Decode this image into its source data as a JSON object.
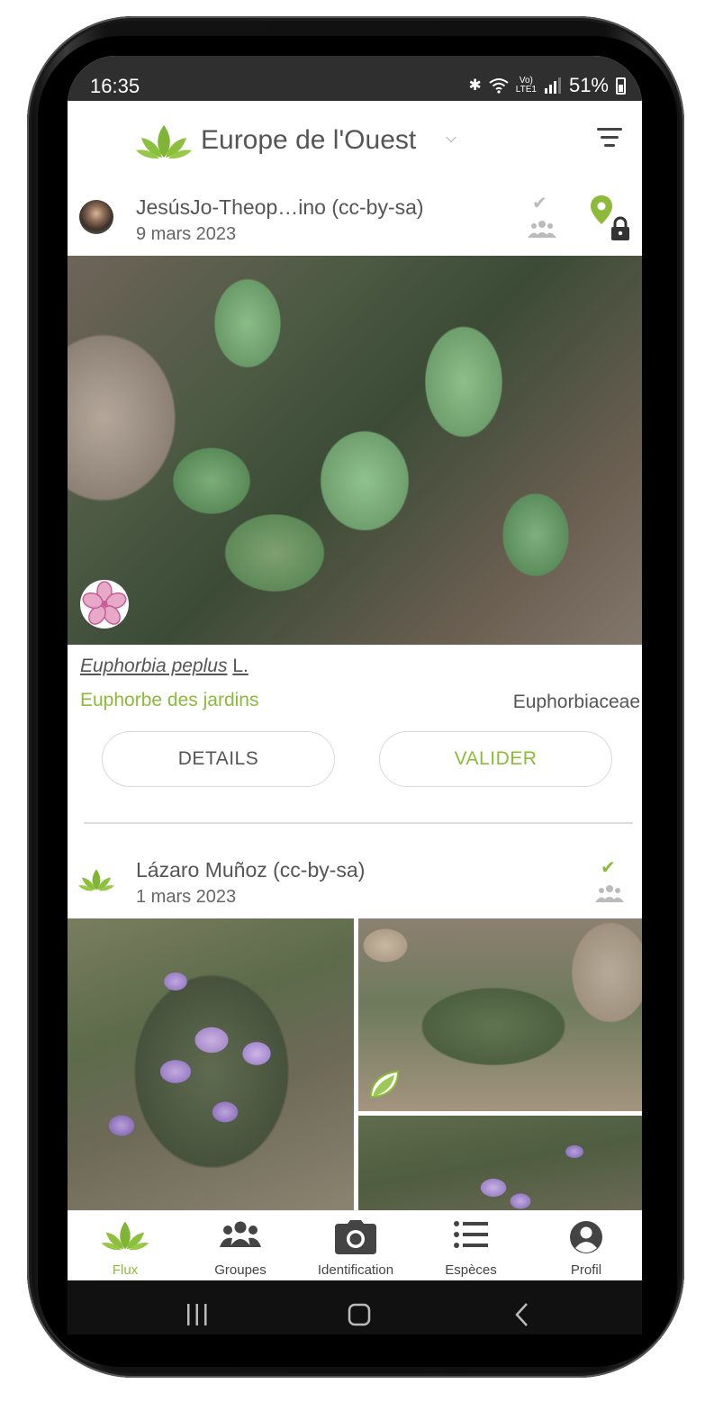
{
  "status_bar": {
    "time": "16:35",
    "icons": [
      "bluetooth-icon",
      "wifi-icon",
      "volte-icon",
      "signal-icon"
    ],
    "battery": "51%"
  },
  "app_bar": {
    "region": "Europe de l'Ouest",
    "filter_icon": "filter-icon"
  },
  "posts": [
    {
      "author": "JesúsJo-Theop…ino (cc-by-sa)",
      "date": "9 mars 2023",
      "scientific_genus_species": "Euphorbia peplus",
      "scientific_author": "L.",
      "common_name": "Euphorbe des jardins",
      "family": "Euphorbiaceae",
      "details_label": "DETAILS",
      "validate_label": "VALIDER"
    },
    {
      "author": "Lázaro Muñoz (cc-by-sa)",
      "date": "1 mars 2023"
    }
  ],
  "bottom_nav": [
    {
      "label": "Flux",
      "icon": "leaf-icon",
      "active": true
    },
    {
      "label": "Groupes",
      "icon": "groups-icon",
      "active": false
    },
    {
      "label": "Identification",
      "icon": "camera-icon",
      "active": false
    },
    {
      "label": "Espèces",
      "icon": "list-icon",
      "active": false
    },
    {
      "label": "Profil",
      "icon": "profile-icon",
      "active": false
    }
  ],
  "colors": {
    "accent": "#8cbb3a",
    "text": "#555555",
    "status_bar": "#2f2f2f"
  }
}
